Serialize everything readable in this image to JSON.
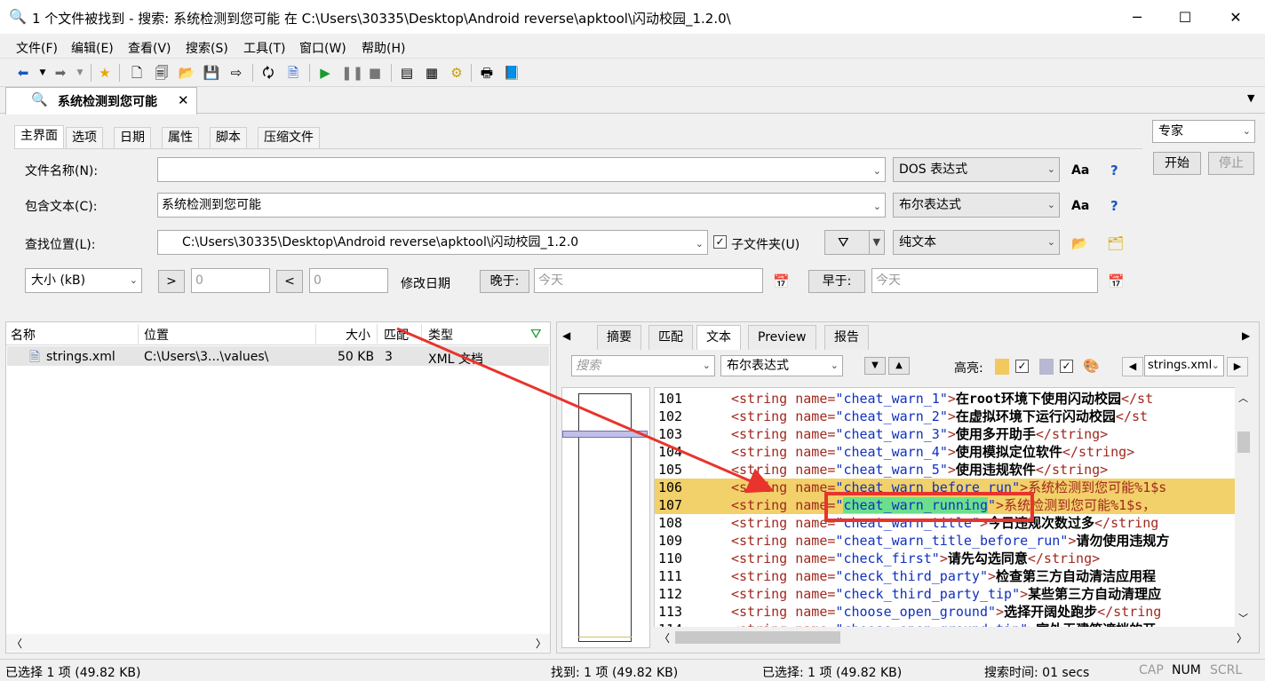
{
  "window": {
    "title": "1 个文件被找到 - 搜索: 系统检测到您可能 在 C:\\Users\\30335\\Desktop\\Android reverse\\apktool\\闪动校园_1.2.0\\"
  },
  "menu": [
    "文件(F)",
    "编辑(E)",
    "查看(V)",
    "搜索(S)",
    "工具(T)",
    "窗口(W)",
    "帮助(H)"
  ],
  "doc_tab": {
    "label": "系统检测到您可能"
  },
  "inner_tabs": [
    "主界面",
    "选项",
    "日期",
    "属性",
    "脚本",
    "压缩文件"
  ],
  "form": {
    "filename_label": "文件名称(N):",
    "filename_value": "",
    "filename_mode": "DOS 表达式",
    "contains_label": "包含文本(C):",
    "contains_value": "系统检测到您可能",
    "contains_mode": "布尔表达式",
    "location_label": "查找位置(L):",
    "location_value": "C:\\Users\\30335\\Desktop\\Android reverse\\apktool\\闪动校园_1.2.0",
    "subfolder_label": "子文件夹(U)",
    "text_type": "纯文本",
    "size_select": "大小 (kB)",
    "gt": ">",
    "lt": "<",
    "size_min": "0",
    "size_max": "0",
    "modified_label": "修改日期",
    "after_label": "晚于:",
    "after_value": "今天",
    "before_label": "早于:",
    "before_value": "今天",
    "aa": "Aa",
    "help": "?"
  },
  "side": {
    "mode": "专家",
    "start": "开始",
    "stop": "停止"
  },
  "results": {
    "columns": [
      "名称",
      "位置",
      "大小",
      "匹配",
      "类型"
    ],
    "rows": [
      {
        "name": "strings.xml",
        "location": "C:\\Users\\3...\\values\\",
        "size": "50 KB",
        "matches": "3",
        "type": "XML 文档"
      }
    ]
  },
  "preview_tabs": [
    "摘要",
    "匹配",
    "文本",
    "Preview",
    "报告"
  ],
  "preview_toolbar": {
    "search_placeholder": "搜索",
    "mode": "布尔表达式",
    "highlight_label": "高亮:",
    "file": "strings.xml"
  },
  "code_lines": [
    {
      "n": "101",
      "name": "cheat_warn_1",
      "text": "在root环境下使用闪动校园",
      "tail": "</st",
      "hl": false
    },
    {
      "n": "102",
      "name": "cheat_warn_2",
      "text": "在虚拟环境下运行闪动校园",
      "tail": "</st",
      "hl": false
    },
    {
      "n": "103",
      "name": "cheat_warn_3",
      "text": "使用多开助手",
      "tail": "</string>",
      "hl": false
    },
    {
      "n": "104",
      "name": "cheat_warn_4",
      "text": "使用模拟定位软件",
      "tail": "</string>",
      "hl": false
    },
    {
      "n": "105",
      "name": "cheat_warn_5",
      "text": "使用违规软件",
      "tail": "</string>",
      "hl": false
    },
    {
      "n": "106",
      "name": "cheat_warn_before_run",
      "text": "系统检测到您可能%1$s",
      "tail": "",
      "hl": true
    },
    {
      "n": "107",
      "name": "cheat_warn_running",
      "text": "系统检测到您可能%1$s，",
      "tail": "",
      "hl": true
    },
    {
      "n": "108",
      "name": "cheat_warn_title",
      "text": "今日违规次数过多",
      "tail": "</string",
      "hl": false
    },
    {
      "n": "109",
      "name": "cheat_warn_title_before_run",
      "text": "请勿使用违规方",
      "tail": "",
      "hl": false
    },
    {
      "n": "110",
      "name": "check_first",
      "text": "请先勾选同意",
      "tail": "</string>",
      "hl": false
    },
    {
      "n": "111",
      "name": "check_third_party",
      "text": "检查第三方自动清洁应用程",
      "tail": "",
      "hl": false
    },
    {
      "n": "112",
      "name": "check_third_party_tip",
      "text": "某些第三方自动清理应",
      "tail": "",
      "hl": false
    },
    {
      "n": "113",
      "name": "choose_open_ground",
      "text": "选择开阔处跑步",
      "tail": "</string",
      "hl": false
    },
    {
      "n": "114",
      "name": "choose_open_ground_tip",
      "text": "室外无建筑遮挡的开",
      "tail": "",
      "hl": false
    }
  ],
  "status": {
    "selected_left": "已选择 1 项 (49.82 KB)",
    "found": "找到: 1 项 (49.82 KB)",
    "selected_right": "已选择: 1 项 (49.82 KB)",
    "time": "搜索时间: 01 secs",
    "cap": "CAP",
    "num": "NUM",
    "scrl": "SCRL"
  },
  "colors": {
    "highlight_line": "#f2d06a",
    "match_word": "#6be08c",
    "annotation_red": "#e8342c"
  }
}
